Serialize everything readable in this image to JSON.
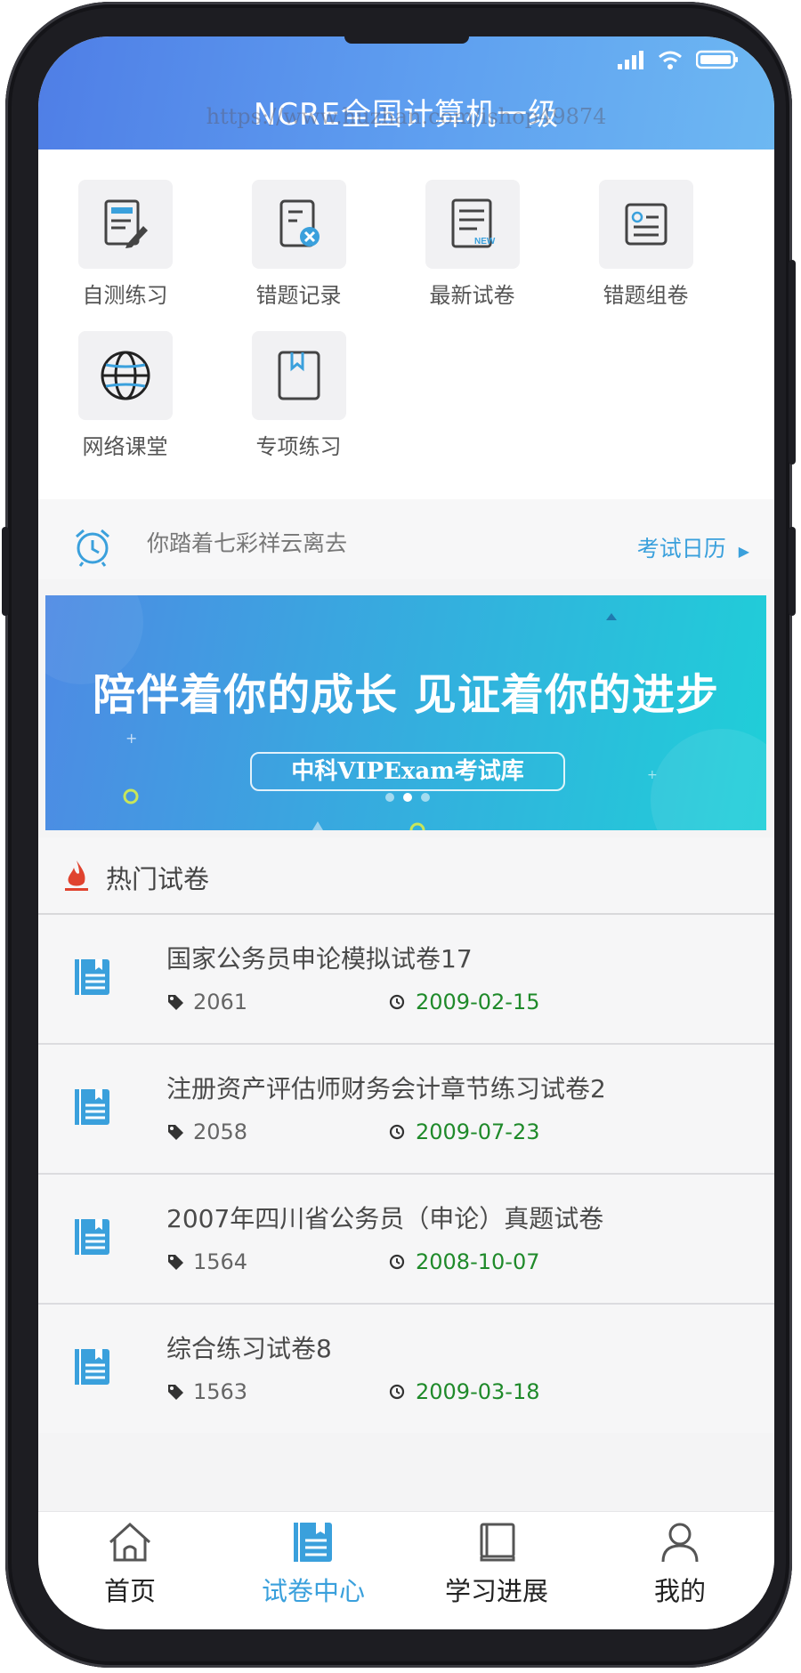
{
  "header": {
    "title": "NCRE全国计算机一级",
    "watermark": "https://www.huzhan.com/ishop49874"
  },
  "grid": [
    {
      "label": "自测练习",
      "icon": "edit-document-icon"
    },
    {
      "label": "错题记录",
      "icon": "wrong-record-icon"
    },
    {
      "label": "最新试卷",
      "icon": "new-paper-icon"
    },
    {
      "label": "错题组卷",
      "icon": "compose-paper-icon"
    },
    {
      "label": "网络课堂",
      "icon": "globe-icon"
    },
    {
      "label": "专项练习",
      "icon": "bookmark-book-icon"
    }
  ],
  "notice": {
    "text": "你踏着七彩祥云离去",
    "link": "考试日历",
    "icon": "alarm-clock-icon"
  },
  "banner": {
    "headline": "陪伴着你的成长 见证着你的进步",
    "pill": "中科VIPExam考试库",
    "slide_count": 3,
    "active_slide": 2
  },
  "hot_papers": {
    "title": "热门试卷",
    "icon": "fire-icon",
    "items": [
      {
        "title": "国家公务员申论模拟试卷17",
        "count": "2061",
        "date": "2009-02-15"
      },
      {
        "title": "注册资产评估师财务会计章节练习试卷2",
        "count": "2058",
        "date": "2009-07-23"
      },
      {
        "title": "2007年四川省公务员（申论）真题试卷",
        "count": "1564",
        "date": "2008-10-07"
      },
      {
        "title": "综合练习试卷8",
        "count": "1563",
        "date": "2009-03-18"
      }
    ]
  },
  "tabbar": [
    {
      "label": "首页",
      "icon": "home-icon",
      "active": false
    },
    {
      "label": "试卷中心",
      "icon": "paper-center-icon",
      "active": true
    },
    {
      "label": "学习进展",
      "icon": "book-stack-icon",
      "active": false
    },
    {
      "label": "我的",
      "icon": "user-icon",
      "active": false
    }
  ],
  "colors": {
    "accent": "#3aa0dc",
    "date_green": "#1f8a2a",
    "header_start": "#4f7ee6",
    "header_end": "#6db8f2"
  }
}
